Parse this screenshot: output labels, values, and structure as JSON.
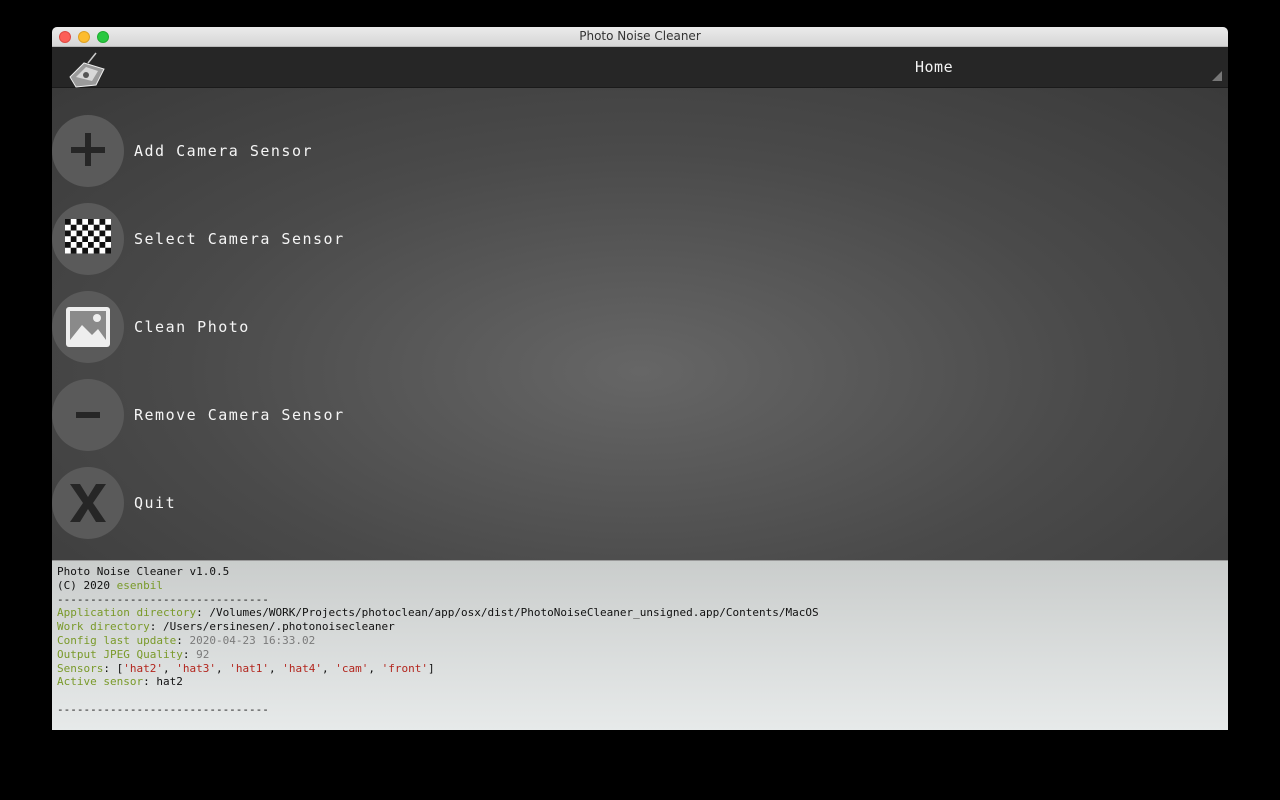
{
  "window": {
    "title": "Photo Noise Cleaner"
  },
  "actionbar": {
    "title": "Home",
    "app_icon": "app-logo-icon"
  },
  "menu": [
    {
      "label": "Add Camera Sensor",
      "icon": "plus-icon"
    },
    {
      "label": "Select Camera Sensor",
      "icon": "checkerboard-icon"
    },
    {
      "label": "Clean Photo",
      "icon": "image-icon"
    },
    {
      "label": "Remove Camera Sensor",
      "icon": "minus-icon"
    },
    {
      "label": "Quit",
      "icon": "close-x-icon"
    }
  ],
  "console": {
    "version_line": "Photo Noise Cleaner v1.0.5",
    "copyright_prefix": "(C) 2020 ",
    "copyright_author": "esenbil",
    "separator": "--------------------------------",
    "app_dir_label": "Application directory",
    "app_dir_value": "/Volumes/WORK/Projects/photoclean/app/osx/dist/PhotoNoiseCleaner_unsigned.app/Contents/MacOS",
    "work_dir_label": "Work directory",
    "work_dir_value": "/Users/ersinesen/.photonoisecleaner",
    "config_label": "Config last update",
    "config_value": "2020-04-23 16:33.02",
    "jpeg_label": "Output JPEG Quality",
    "jpeg_value": "92",
    "sensors_label": "Sensors",
    "sensors": [
      "'hat2'",
      "'hat3'",
      "'hat1'",
      "'hat4'",
      "'cam'",
      "'front'"
    ],
    "active_label": "Active sensor",
    "active_value": "hat2",
    "separator_end": "--------------------------------"
  },
  "colors": {
    "key": "#7a9a2a",
    "string": "#b3261e",
    "menu_circle": "#5a5a5a"
  }
}
